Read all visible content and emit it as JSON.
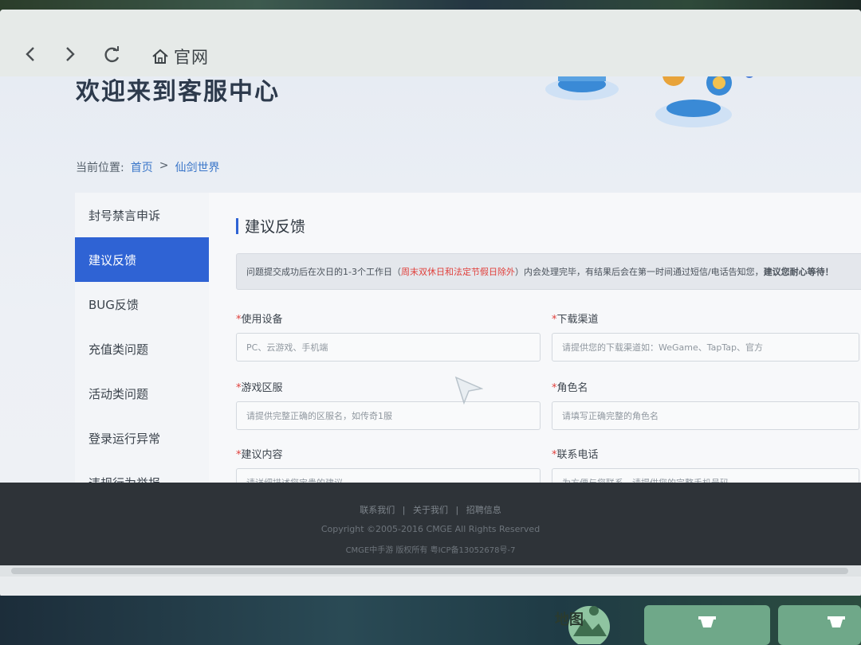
{
  "browser": {
    "home_label": "官网"
  },
  "page": {
    "hero_title": "欢迎来到客服中心",
    "breadcrumb": {
      "prefix": "当前位置:",
      "home": "首页",
      "separator": ">",
      "current": "仙剑世界"
    }
  },
  "sidebar": {
    "items": [
      {
        "label": "封号禁言申诉"
      },
      {
        "label": "建议反馈"
      },
      {
        "label": "BUG反馈"
      },
      {
        "label": "充值类问题"
      },
      {
        "label": "活动类问题"
      },
      {
        "label": "登录运行异常"
      },
      {
        "label": "违规行为举报"
      }
    ]
  },
  "form": {
    "title": "建议反馈",
    "notice": {
      "part1": "问题提交成功后在次日的1-3个工作日（",
      "red": "周末双休日和法定节假日除外",
      "part2": "）内会处理完毕，有结果后会在第一时间通过短信/电话告知您，",
      "bold": "建议您耐心等待！"
    },
    "required_mark": "*",
    "fields": {
      "device": {
        "label": "使用设备",
        "placeholder": "PC、云游戏、手机端"
      },
      "channel": {
        "label": "下载渠道",
        "placeholder": "请提供您的下载渠道如：WeGame、TapTap、官方"
      },
      "server": {
        "label": "游戏区服",
        "placeholder": "请提供完整正确的区服名，如传奇1服"
      },
      "role": {
        "label": "角色名",
        "placeholder": "请填写正确完整的角色名"
      },
      "content": {
        "label": "建议内容",
        "placeholder": "请详细描述您宝贵的建议"
      },
      "phone": {
        "label": "联系电话",
        "placeholder": "为方便与您联系，请提供您的完整手机号码"
      }
    }
  },
  "footer": {
    "links": [
      "联系我们",
      "关于我们",
      "招聘信息"
    ],
    "divider": "|",
    "copyright": "Copyright ©2005-2016 CMGE All Rights Reserved",
    "icp": "CMGE中手游 版权所有 粤ICP备13052678号-7"
  },
  "game_ui": {
    "map_label": "地图"
  },
  "colors": {
    "accent": "#2f63d4",
    "warning": "#e0403c",
    "footer_bg": "#2e3338"
  }
}
